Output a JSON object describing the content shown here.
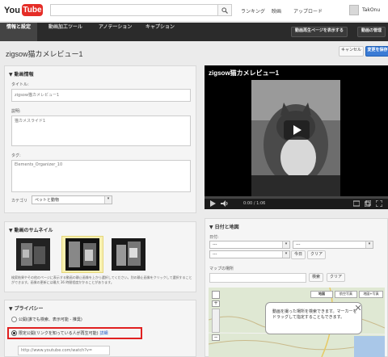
{
  "masthead": {
    "logo_you": "You",
    "logo_tube": "Tube",
    "links": [
      "ランキング",
      "映画",
      "アップロード"
    ],
    "user_name": "TakOnu"
  },
  "tabs": [
    "情報と設定",
    "動画加工ツール",
    "アノテーション",
    "キャプション"
  ],
  "tab_buttons": [
    "動画再生ページを表示する",
    "動画の管理"
  ],
  "page": {
    "title": "zigsow猫カメレビュー1",
    "cancel_label": "キャンセル",
    "save_label": "変更を保存"
  },
  "video_info": {
    "header": "動画情報",
    "title_label": "タイトル:",
    "title_value": "zigsow猫カメレビュー1",
    "desc_label": "説明:",
    "desc_value": "猫カメスライド1",
    "tags_label": "タグ:",
    "tags_value": "Elements_Organizer_10",
    "category_label": "カテゴリ",
    "category_value": "ペットと動物"
  },
  "thumbnail": {
    "header": "動画のサムネイル",
    "note": "検索結果やその他のページに表示する動画の静止画像を上から選択してください。別の静止画像をクリックして選択することができます。画像の更新には最大 36 時間程度かかることがあります。"
  },
  "privacy": {
    "header": "プライバシー",
    "option_public": "公開(誰でも検索、表示可能 - 推奨)",
    "option_unlisted": "限定公開(リンクを知っている人が再生可能)",
    "details_link": "詳細",
    "url_value": "http://www.youtube.com/watch?v="
  },
  "player": {
    "title": "zigsow猫カメレビュー1",
    "time": "0:00 / 1:06",
    "progress": 0
  },
  "date_map": {
    "header": "日付と地図",
    "date_label": "日付:",
    "date_select_1": "---",
    "date_select_2": "---",
    "date_select_3": "---",
    "today_btn": "今日",
    "clear_btn": "クリア",
    "map_place_label": "マップの場所",
    "search_btn": "検索",
    "map_clear_btn": "クリア",
    "map_tabs": [
      "地図",
      "航空写真",
      "地図+写真"
    ],
    "bubble_text": "動画を撮った場所を検索できます。マーカーをドラッグして指定することもできます。"
  },
  "colors": {
    "accent": "#3a7bd5",
    "highlight_border": "#e02020",
    "tabbar": "#2b2b2b",
    "logo_red": "#e52d27"
  }
}
